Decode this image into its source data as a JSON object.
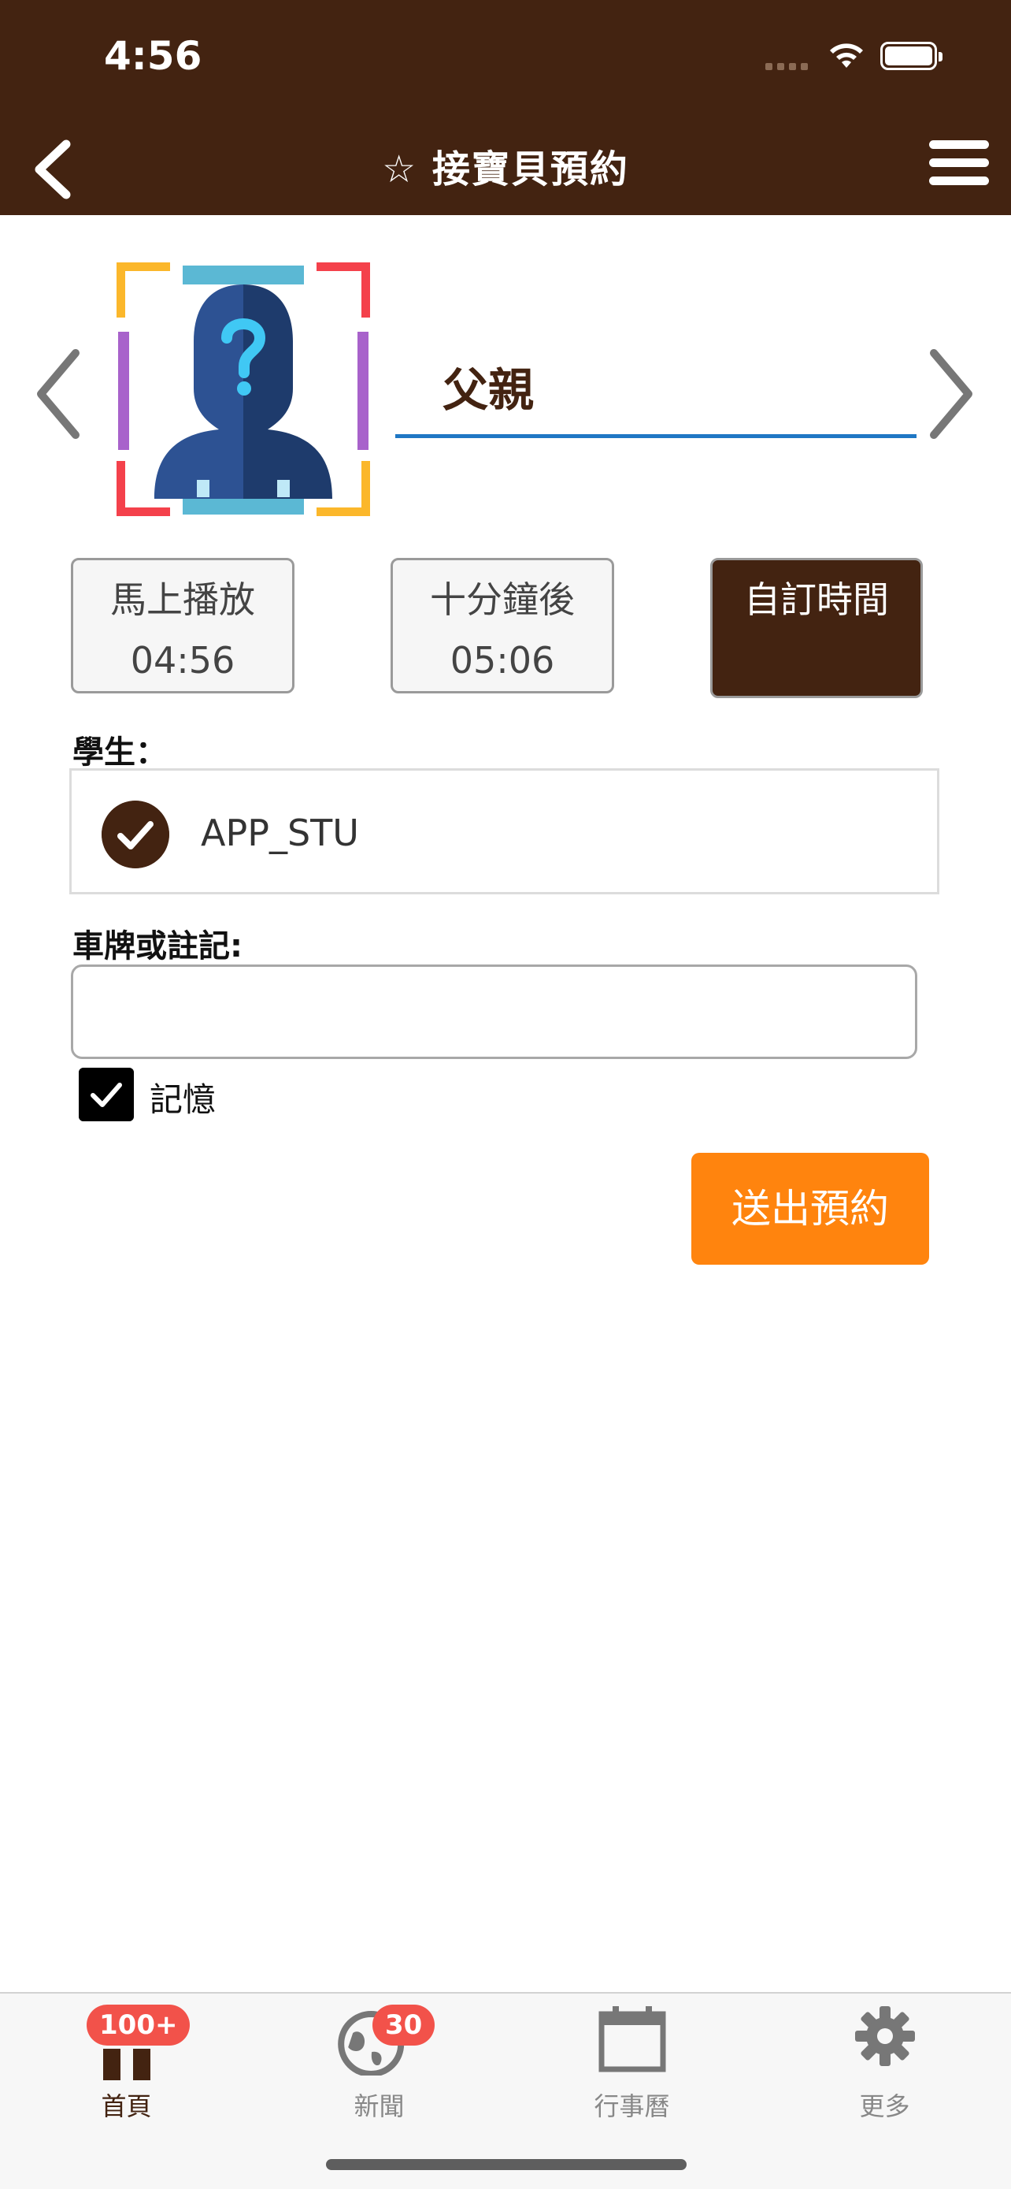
{
  "status": {
    "time": "4:56"
  },
  "header": {
    "title": "☆ 接寶貝預約"
  },
  "parent": {
    "name": "父親"
  },
  "time_options": [
    {
      "label": "馬上播放",
      "value": "04:56"
    },
    {
      "label": "十分鐘後",
      "value": "05:06"
    },
    {
      "label": "自訂時間",
      "value": ""
    }
  ],
  "student": {
    "section_label": "學生：",
    "name": "APP_STU",
    "checked": true
  },
  "note": {
    "section_label": "車牌或註記:",
    "value": "",
    "placeholder": ""
  },
  "remember": {
    "label": "記憶",
    "checked": true
  },
  "submit": {
    "label": "送出預約"
  },
  "tabs": [
    {
      "label": "首頁",
      "badge": "100+",
      "icon": "home-icon",
      "active": true
    },
    {
      "label": "新聞",
      "badge": "30",
      "icon": "globe-icon",
      "active": false
    },
    {
      "label": "行事曆",
      "badge": "",
      "icon": "calendar-icon",
      "active": false
    },
    {
      "label": "更多",
      "badge": "",
      "icon": "gear-icon",
      "active": false
    }
  ],
  "colors": {
    "header": "#432311",
    "accent": "#ff840e",
    "underline": "#1f77c4",
    "badge": "#f2524a"
  }
}
